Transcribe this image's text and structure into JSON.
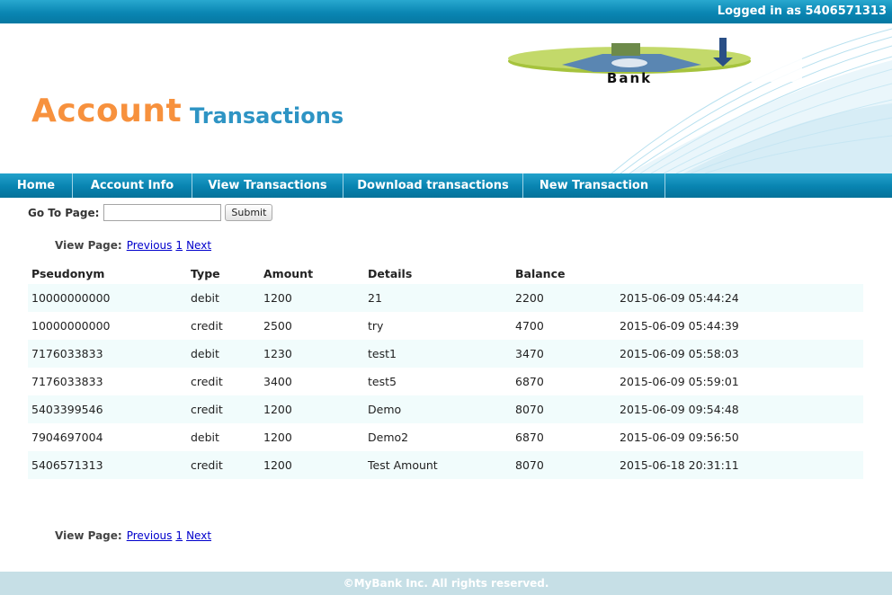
{
  "header": {
    "logged_in_text": "Logged in as 5406571313"
  },
  "banner": {
    "title_main": "Account",
    "title_sub": "Transactions",
    "logo_text": "Bank"
  },
  "nav": {
    "items": [
      {
        "label": "Home"
      },
      {
        "label": "Account Info"
      },
      {
        "label": "View Transactions"
      },
      {
        "label": "Download transactions"
      },
      {
        "label": "New Transaction"
      }
    ]
  },
  "goto_page": {
    "label": "Go To Page:",
    "value": "",
    "submit_label": "Submit"
  },
  "pager": {
    "label": "View Page:",
    "previous": "Previous",
    "page": "1",
    "next": "Next"
  },
  "table": {
    "headers": [
      "Pseudonym",
      "Type",
      "Amount",
      "Details",
      "Balance",
      ""
    ],
    "rows": [
      [
        "10000000000",
        "debit",
        "1200",
        "21",
        "2200",
        "2015-06-09 05:44:24"
      ],
      [
        "10000000000",
        "credit",
        "2500",
        "try",
        "4700",
        "2015-06-09 05:44:39"
      ],
      [
        "7176033833",
        "debit",
        "1230",
        "test1",
        "3470",
        "2015-06-09 05:58:03"
      ],
      [
        "7176033833",
        "credit",
        "3400",
        "test5",
        "6870",
        "2015-06-09 05:59:01"
      ],
      [
        "5403399546",
        "credit",
        "1200",
        "Demo",
        "8070",
        "2015-06-09 09:54:48"
      ],
      [
        "7904697004",
        "debit",
        "1200",
        "Demo2",
        "6870",
        "2015-06-09 09:56:50"
      ],
      [
        "5406571313",
        "credit",
        "1200",
        "Test Amount",
        "8070",
        "2015-06-18 20:31:11"
      ]
    ]
  },
  "footer": {
    "text": "©MyBank Inc. All rights reserved."
  },
  "colors": {
    "orange": "#f7913d",
    "blue": "#2e94c4",
    "nav": "#0883b0"
  }
}
